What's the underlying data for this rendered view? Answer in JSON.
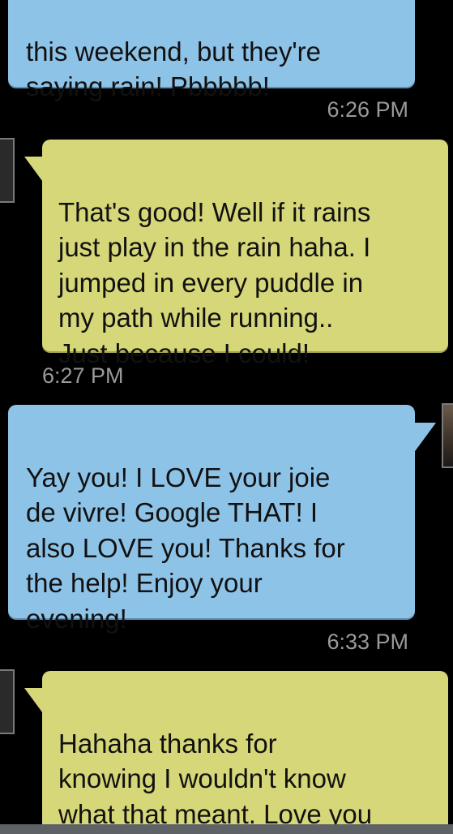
{
  "messages": [
    {
      "sender": "me",
      "text": "this weekend, but they're\nsaying rain! Pbbbbb!",
      "time": "6:26 PM"
    },
    {
      "sender": "them",
      "text": "That's good! Well if it rains\njust play in the rain haha. I\njumped in every puddle in\nmy path while running..\nJust because I could!",
      "time": "6:27 PM"
    },
    {
      "sender": "me",
      "text": "Yay you! I LOVE your joie\nde vivre! Google THAT! I\nalso LOVE you! Thanks for\nthe help! Enjoy your\nevening!",
      "time": "6:33 PM"
    },
    {
      "sender": "them",
      "text": "Hahaha thanks for\nknowing I wouldn't know\nwhat that meant. Love you\ntoo and thanks you too!",
      "time": ""
    }
  ],
  "colors": {
    "background": "#000000",
    "my_bubble": "#8ec3e8",
    "their_bubble": "#d6d778",
    "timestamp": "#9a9a9a"
  }
}
